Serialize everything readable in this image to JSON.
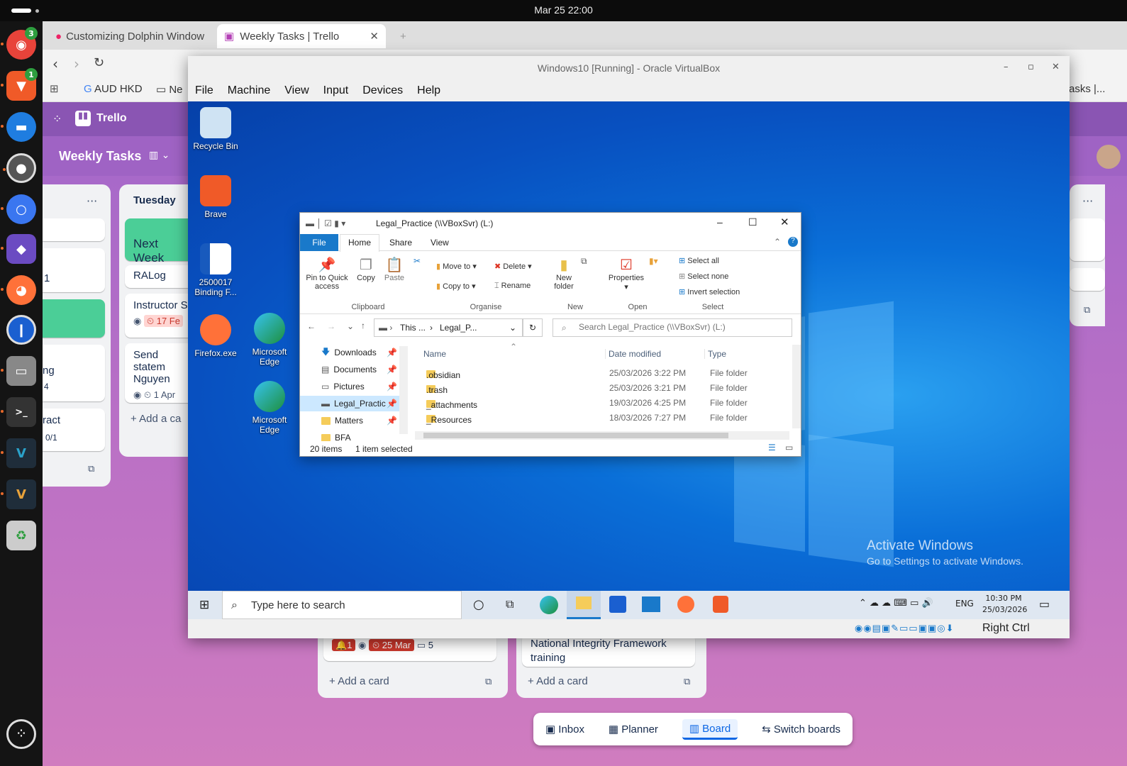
{
  "topbar": {
    "clock": "Mar 25  22:00"
  },
  "dock": {
    "apps": [
      {
        "name": "firefox-dev-icon",
        "badge": "3",
        "color": "#e8433a"
      },
      {
        "name": "brave-icon",
        "badge": "1",
        "color": "#f05a28"
      },
      {
        "name": "chat-icon",
        "badge": "",
        "color": "#1f7de0"
      },
      {
        "name": "record-icon",
        "badge": "",
        "color": "#666"
      },
      {
        "name": "signal-icon",
        "badge": "",
        "color": "#3a76f0"
      },
      {
        "name": "obsidian-icon",
        "badge": "",
        "color": "#6b4bc2"
      },
      {
        "name": "firefox-icon",
        "badge": "",
        "color": "#ff7139"
      },
      {
        "name": "onepassword-icon",
        "badge": "",
        "color": "#1a5fd0"
      },
      {
        "name": "files-icon",
        "badge": "",
        "color": "#a0a0a0"
      },
      {
        "name": "terminal-icon",
        "badge": "",
        "color": "#333"
      },
      {
        "name": "vscode-icon-1",
        "badge": "",
        "color": "#2aa1c9"
      },
      {
        "name": "vscode-icon-2",
        "badge": "",
        "color": "#2aa1c9"
      },
      {
        "name": "trash-icon",
        "badge": "",
        "color": "#888"
      }
    ]
  },
  "browser": {
    "tabs": [
      {
        "label": "Customizing Dolphin Window"
      },
      {
        "label": "Weekly Tasks | Trello"
      }
    ],
    "bookmarks": {
      "aud": "AUD HKD",
      "new": "Ne",
      "right": "asks |..."
    }
  },
  "trello": {
    "app_name": "Trello",
    "board_name": "Weekly Tasks",
    "lists": {
      "left": {
        "cards": [
          "",
          "1",
          "",
          "ng",
          "4",
          "ract",
          "0/1"
        ]
      },
      "tuesday": {
        "title": "Tuesday",
        "next_week": "Next Week",
        "ralog": "RALog",
        "instructor": "Instructor S",
        "instructor_date": "17 Fe",
        "send": "Send statem",
        "send_name": "Nguyen",
        "send_date": "1 Apr",
        "add": "Add a ca"
      },
      "bottom1": {
        "notif": "1",
        "date": "25 Mar",
        "comments": "5",
        "add": "Add a card"
      },
      "bottom2": {
        "card": "National Integrity Framework training",
        "add": "Add a card"
      }
    },
    "nav": {
      "inbox": "Inbox",
      "planner": "Planner",
      "board": "Board",
      "switch": "Switch boards"
    }
  },
  "vbox": {
    "title": "Windows10 [Running] - Oracle VirtualBox",
    "menu": [
      "File",
      "Machine",
      "View",
      "Input",
      "Devices",
      "Help"
    ],
    "status": "Right Ctrl"
  },
  "desktop": {
    "icons": {
      "recycle": "Recycle Bin",
      "brave": "Brave",
      "word": "2500017 Binding F...",
      "firefox": "Firefox.exe",
      "edge1": "Microsoft Edge",
      "edge2": "Microsoft Edge"
    },
    "activate_title": "Activate Windows",
    "activate_sub": "Go to Settings to activate Windows."
  },
  "taskbar": {
    "search_placeholder": "Type here to search",
    "lang": "ENG",
    "time": "10:30 PM",
    "date": "25/03/2026"
  },
  "explorer": {
    "title": "Legal_Practice (\\\\VBoxSvr) (L:)",
    "ribbon_tabs": [
      "File",
      "Home",
      "Share",
      "View"
    ],
    "clipboard": {
      "pin": "Pin to Quick access",
      "copy": "Copy",
      "paste": "Paste",
      "group": "Clipboard"
    },
    "organise": {
      "move": "Move to",
      "copy": "Copy to",
      "delete": "Delete",
      "rename": "Rename",
      "group": "Organise"
    },
    "new": {
      "folder": "New folder",
      "group": "New"
    },
    "open": {
      "properties": "Properties",
      "group": "Open"
    },
    "select": {
      "all": "Select all",
      "none": "Select none",
      "invert": "Invert selection",
      "group": "Select"
    },
    "address": {
      "this": "This ...",
      "path": "Legal_P..."
    },
    "search_placeholder": "Search Legal_Practice (\\\\VBoxSvr) (L:)",
    "nav": [
      "Downloads",
      "Documents",
      "Pictures",
      "Legal_Practic",
      "Matters",
      "BFA"
    ],
    "columns": {
      "name": "Name",
      "date": "Date modified",
      "type": "Type"
    },
    "files": [
      {
        "name": ".obsidian",
        "date": "25/03/2026 3:22 PM",
        "type": "File folder"
      },
      {
        "name": ".trash",
        "date": "25/03/2026 3:21 PM",
        "type": "File folder"
      },
      {
        "name": "_attachments",
        "date": "19/03/2026 4:25 PM",
        "type": "File folder"
      },
      {
        "name": "_Resources",
        "date": "18/03/2026 7:27 PM",
        "type": "File folder"
      }
    ],
    "status": {
      "items": "20 items",
      "selected": "1 item selected"
    }
  }
}
